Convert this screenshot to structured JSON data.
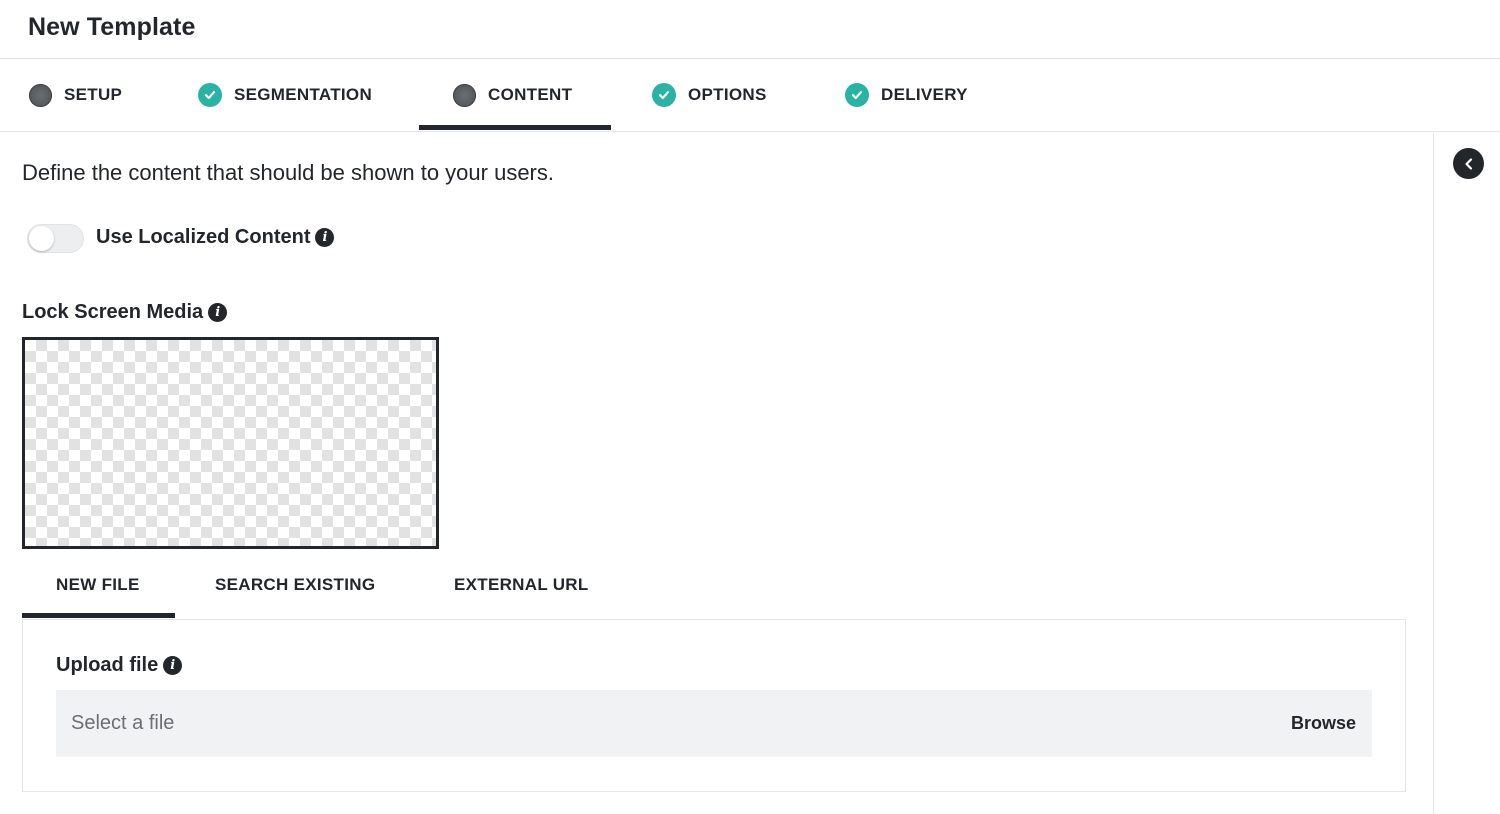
{
  "page": {
    "title": "New Template"
  },
  "steps": [
    {
      "label": "SETUP",
      "status": "current-dot"
    },
    {
      "label": "SEGMENTATION",
      "status": "complete"
    },
    {
      "label": "CONTENT",
      "status": "active"
    },
    {
      "label": "OPTIONS",
      "status": "complete"
    },
    {
      "label": "DELIVERY",
      "status": "complete"
    }
  ],
  "content": {
    "intro": "Define the content that should be shown to your users.",
    "localized_toggle": {
      "label": "Use Localized Content",
      "on": false
    },
    "lock_screen_media": {
      "label": "Lock Screen Media"
    },
    "media_tabs": [
      {
        "label": "NEW FILE",
        "active": true
      },
      {
        "label": "SEARCH EXISTING",
        "active": false
      },
      {
        "label": "EXTERNAL URL",
        "active": false
      }
    ],
    "upload": {
      "label": "Upload file",
      "placeholder": "Select a file",
      "browse_label": "Browse"
    }
  },
  "colors": {
    "accent_check": "#2ab3a3",
    "dark": "#23272b",
    "field_bg": "#f1f2f4"
  },
  "icons": {
    "info": "info-icon",
    "check": "check-icon",
    "collapse": "chevron-left-icon"
  }
}
